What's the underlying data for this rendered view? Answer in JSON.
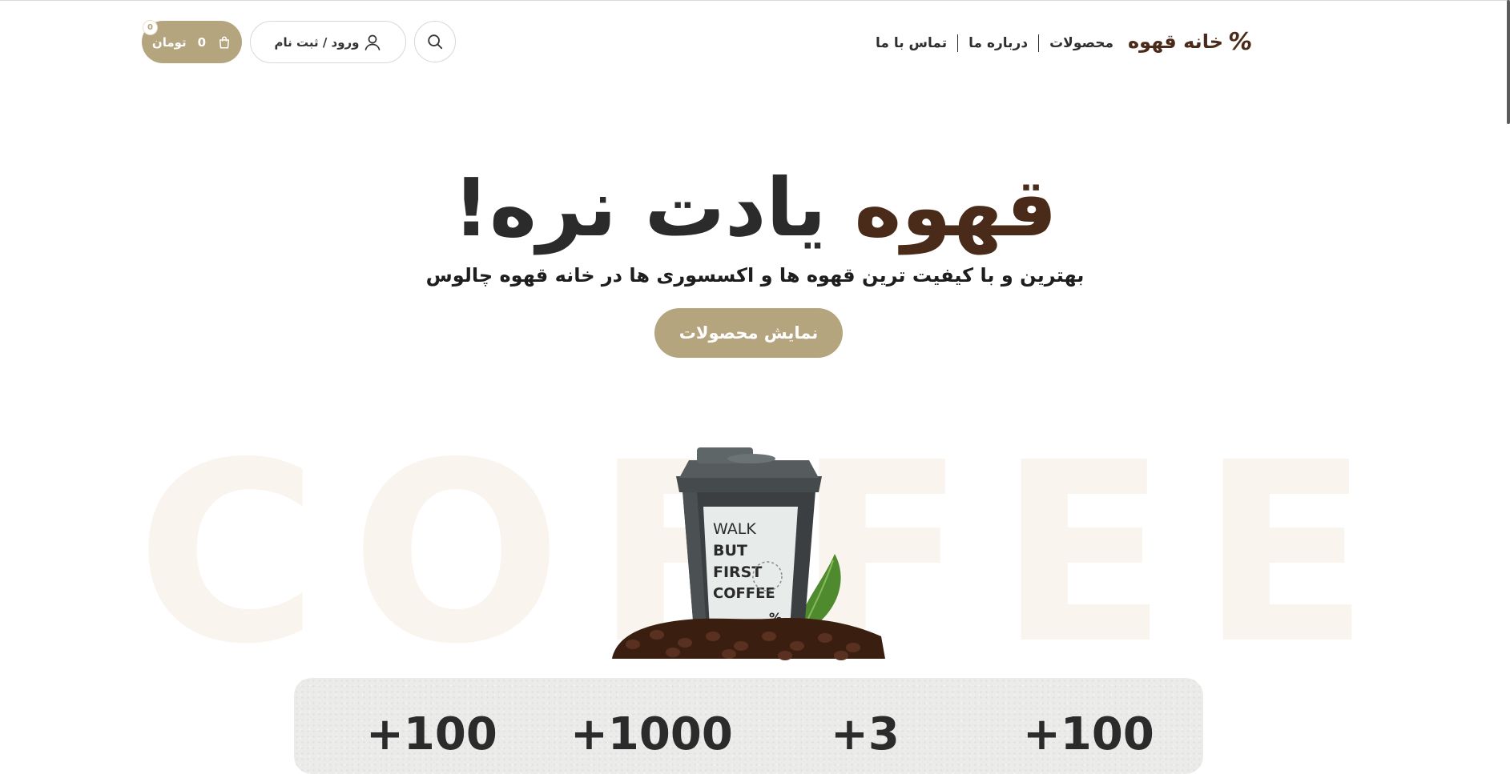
{
  "header": {
    "logo": {
      "mark": "%",
      "text": "خانه قهوه"
    },
    "nav": [
      {
        "label": "محصولات"
      },
      {
        "label": "درباره ما"
      },
      {
        "label": "تماس با ما"
      }
    ],
    "login_label": "ورود / ثبت نام",
    "cart": {
      "amount": "0",
      "currency": "تومان",
      "badge_count": "0"
    },
    "icons": {
      "search": "search-icon",
      "user": "user-icon",
      "cart": "shopping-bag-icon"
    }
  },
  "hero": {
    "title_accent": "قهوه",
    "title_rest": "یادت نره!",
    "subtitle": "بهترین و با کیفیت ترین قهوه ها و اکسسوری ها در خانه قهوه چالوس",
    "cta_label": "نمایش محصولات",
    "background_word": [
      "C",
      "O",
      "F",
      "F",
      "E",
      "E"
    ]
  },
  "cup": {
    "sleeve_lines": [
      "WALK",
      "BUT",
      "FIRST",
      "COFFEE"
    ],
    "mark": "%"
  },
  "stats": [
    "+100",
    "+1000",
    "+3",
    "+100"
  ],
  "colors": {
    "accent": "#b4a57e",
    "brand_brown": "#4a2a18",
    "text": "#2b2b2b",
    "background_word": "#faf4ef"
  }
}
